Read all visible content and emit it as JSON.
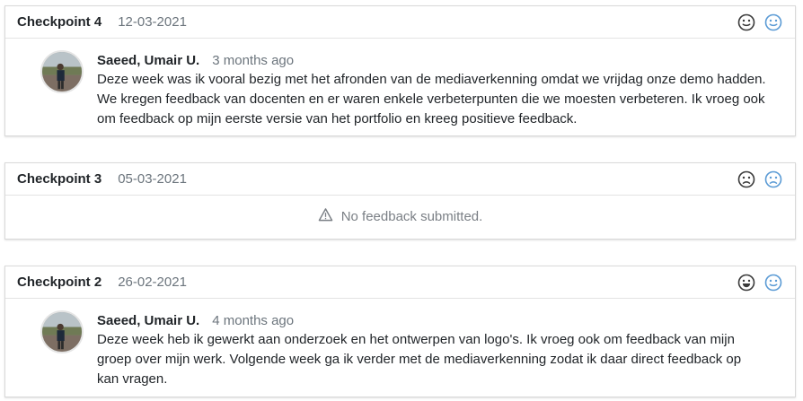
{
  "checkpoints": [
    {
      "title": "Checkpoint 4",
      "date": "12-03-2021",
      "mood": "neutral",
      "entry": {
        "author": "Saeed, Umair U.",
        "ago": "3 months ago",
        "lines": [
          "Deze week was ik vooral bezig met het afronden van de mediaverkenning omdat we vrijdag onze demo hadden.",
          "We kregen feedback van docenten en er waren enkele verbeterpunten die we moesten verbeteren. Ik vroeg ook",
          "om feedback op mijn eerste versie van het portfolio en kreeg positieve feedback."
        ]
      }
    },
    {
      "title": "Checkpoint 3",
      "date": "05-03-2021",
      "mood": "sad",
      "empty_text": "No feedback submitted."
    },
    {
      "title": "Checkpoint 2",
      "date": "26-02-2021",
      "mood": "happy",
      "entry": {
        "author": "Saeed, Umair U.",
        "ago": "4 months ago",
        "lines": [
          "Deze week heb ik gewerkt aan onderzoek en het ontwerpen van logo's. Ik vroeg ook om feedback van mijn",
          "groep over mijn werk. Volgende week ga ik verder met de mediaverkenning zodat ik daar direct feedback op",
          "kan vragen."
        ]
      }
    }
  ],
  "colors": {
    "dark_face": "#3a3a3a",
    "blue_face": "#5b9bd5",
    "muted_text": "#6c757d"
  },
  "icons": {
    "neutral": "neutral-face-icon",
    "sad": "sad-face-icon",
    "happy": "happy-face-icon",
    "warning": "warning-triangle-icon"
  }
}
